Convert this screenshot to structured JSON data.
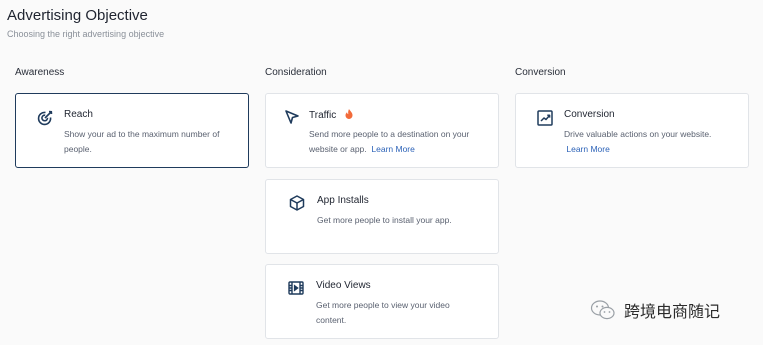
{
  "header": {
    "title": "Advertising Objective",
    "subtitle": "Choosing the right advertising objective"
  },
  "columns": {
    "awareness": "Awareness",
    "consideration": "Consideration",
    "conversion": "Conversion"
  },
  "cards": {
    "reach": {
      "name": "Reach",
      "desc": "Show your ad to the maximum number of people.",
      "icon": "target-icon",
      "selected": true
    },
    "traffic": {
      "name": "Traffic",
      "desc": "Send more people to a destination on your website or app.",
      "link": "Learn More",
      "icon": "cursor-icon",
      "badge": "flame-icon"
    },
    "app_installs": {
      "name": "App Installs",
      "desc": "Get more people to install your app.",
      "icon": "box-icon"
    },
    "video_views": {
      "name": "Video Views",
      "desc": "Get more people to view your video content.",
      "icon": "film-icon"
    },
    "conversion": {
      "name": "Conversion",
      "desc": "Drive valuable actions on your website.",
      "link": "Learn More",
      "icon": "trend-chart-icon"
    }
  },
  "watermark": {
    "text": "跨境电商随记",
    "icon": "wechat-icon"
  },
  "colors": {
    "selected_border": "#1f3b5c",
    "link": "#2d63b8",
    "flame": "#f26b3a"
  }
}
